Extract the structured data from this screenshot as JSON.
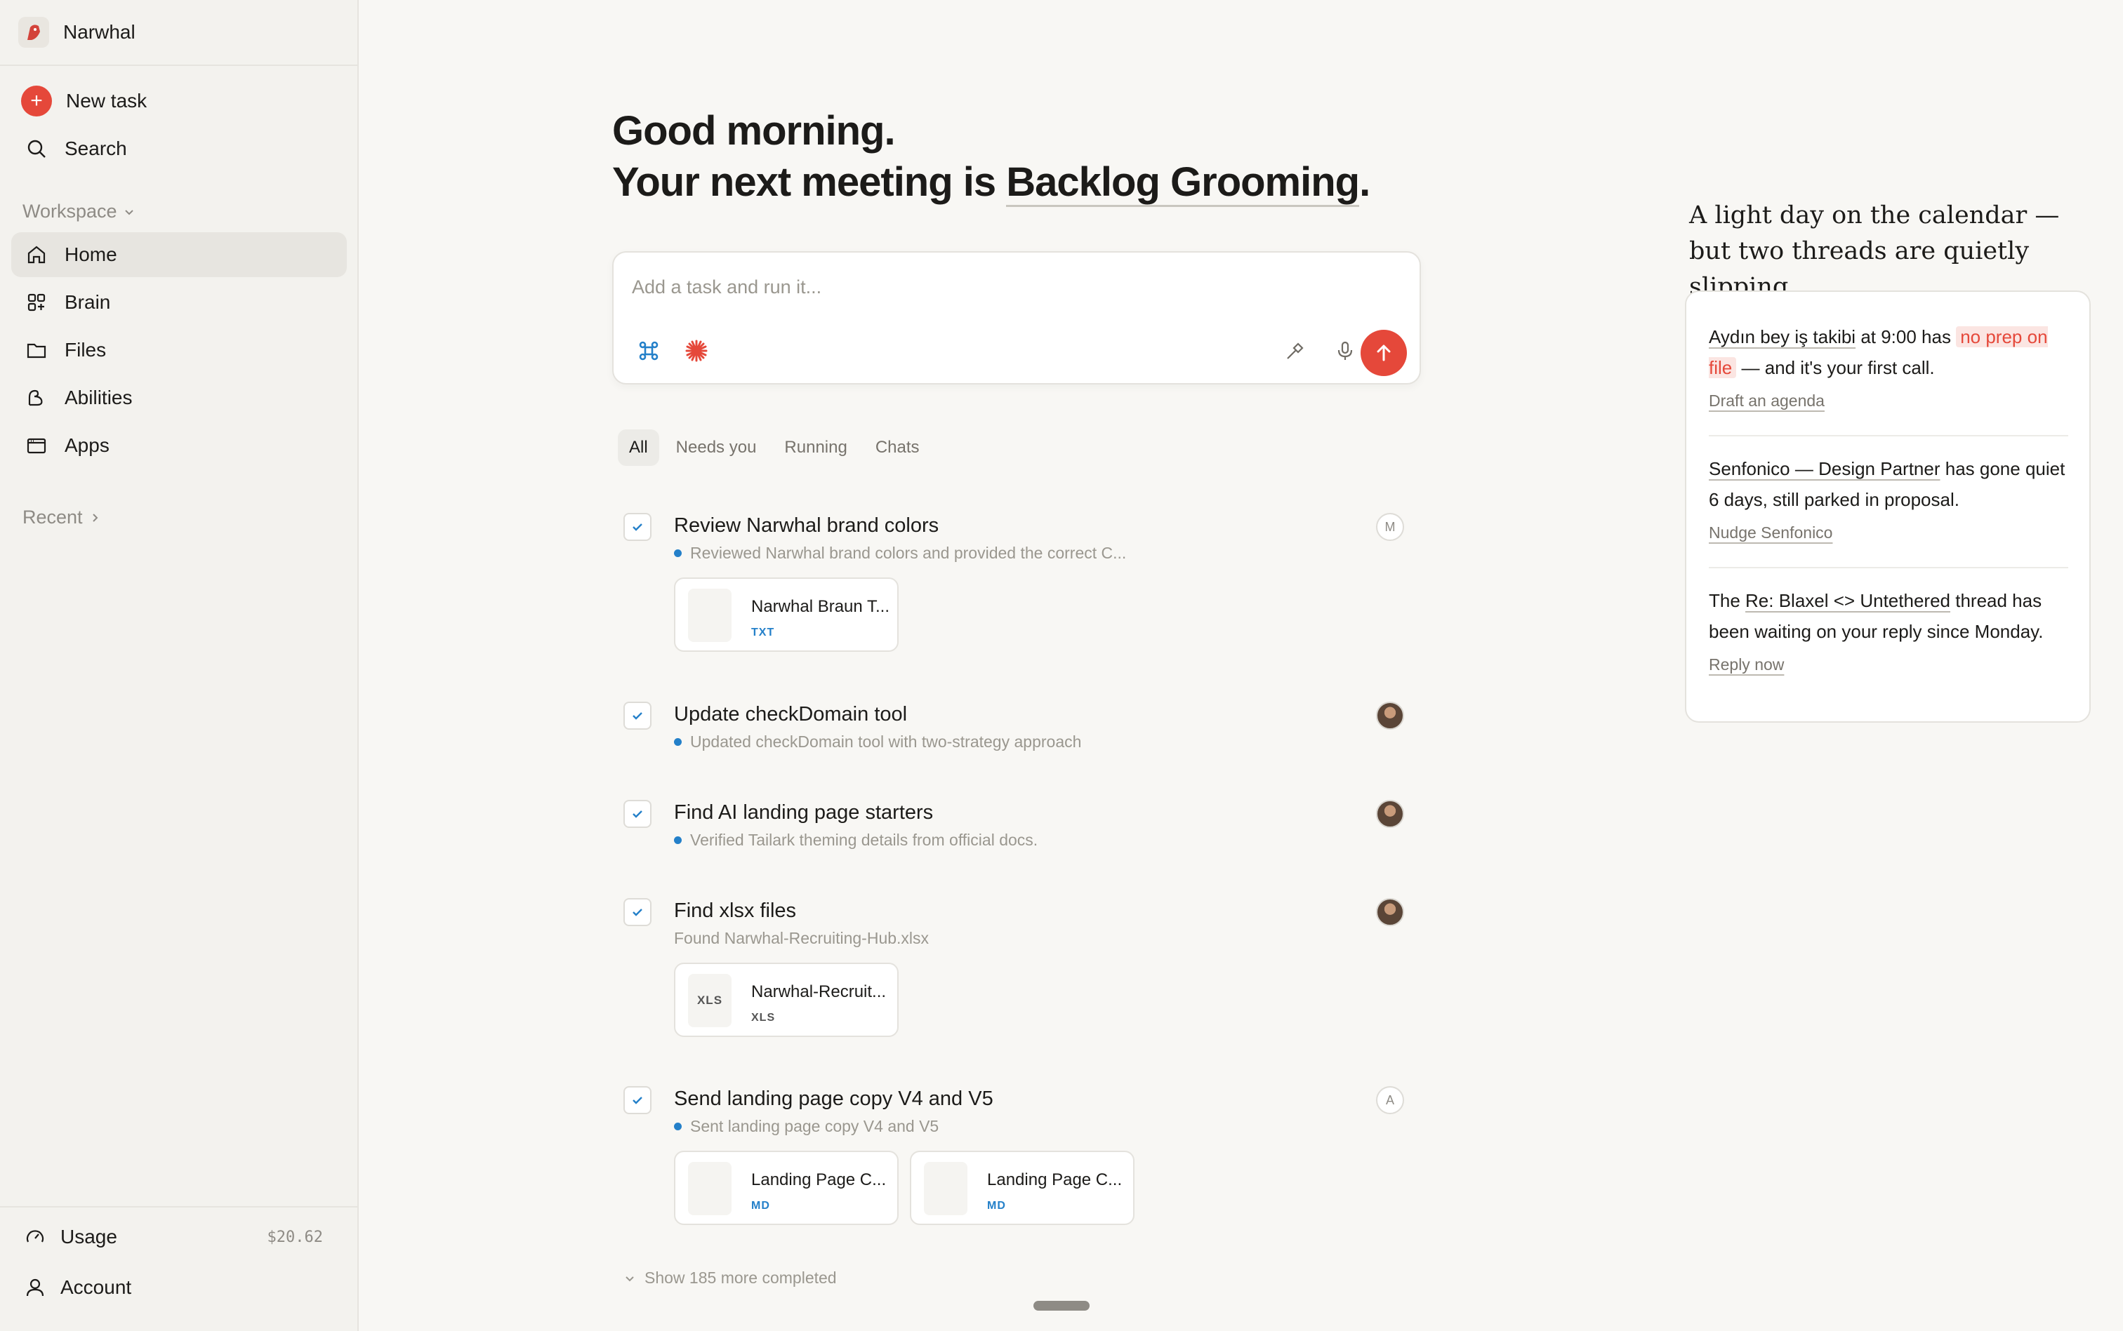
{
  "sidebar": {
    "brand": "Narwhal",
    "new_task": "New task",
    "search": "Search",
    "workspace": "Workspace",
    "nav": [
      {
        "label": "Home",
        "icon": "home-icon"
      },
      {
        "label": "Brain",
        "icon": "brain-icon"
      },
      {
        "label": "Files",
        "icon": "folder-icon"
      },
      {
        "label": "Abilities",
        "icon": "abilities-icon"
      },
      {
        "label": "Apps",
        "icon": "apps-icon"
      }
    ],
    "recent": "Recent",
    "usage": "Usage",
    "usage_amount": "$20.62",
    "account": "Account"
  },
  "main": {
    "greeting_line1": "Good morning.",
    "greeting_line2_prefix": "Your next meeting is ",
    "meeting_name": "Backlog Grooming",
    "greeting_line2_suffix": ".",
    "composer_placeholder": "Add a task and run it...",
    "tabs": [
      "All",
      "Needs you",
      "Running",
      "Chats"
    ],
    "tasks": [
      {
        "title": "Review Narwhal brand colors",
        "subtitle": "Reviewed Narwhal brand colors and provided the correct C...",
        "avatar": "M",
        "files": [
          {
            "name": "Narwhal Braun T...",
            "ext": "TXT"
          }
        ]
      },
      {
        "title": "Update checkDomain tool",
        "subtitle": "Updated checkDomain tool with two-strategy approach"
      },
      {
        "title": "Find AI landing page starters",
        "subtitle": "Verified Tailark theming details from official docs."
      },
      {
        "title": "Find xlsx files",
        "subtitle": "Found Narwhal-Recruiting-Hub.xlsx",
        "files": [
          {
            "name": "Narwhal-Recruit...",
            "ext": "XLS",
            "icon_text": "XLS"
          }
        ]
      },
      {
        "title": "Send landing page copy V4 and V5",
        "subtitle": "Sent landing page copy V4 and V5",
        "avatar": "A",
        "files": [
          {
            "name": "Landing Page C...",
            "ext": "MD"
          },
          {
            "name": "Landing Page C...",
            "ext": "MD"
          }
        ]
      }
    ],
    "show_more": "Show 185 more completed"
  },
  "digest": {
    "heading": "A light day on the calendar — but two threads are quietly slipping.",
    "items": [
      {
        "link": "Aydın bey iş takibi",
        "text1": " at 9:00 has ",
        "highlight": "no prep on file",
        "text2": " — and it's your first call.",
        "action": "Draft an agenda"
      },
      {
        "link": "Senfonico — Design Partner",
        "text1": " has gone quiet 6 days, still parked in proposal.",
        "action": "Nudge Senfonico"
      },
      {
        "prefix": "The ",
        "link": "Re: Blaxel <> Untethered",
        "text1": " thread has been waiting on your reply since Monday.",
        "action": "Reply now"
      }
    ]
  },
  "colors": {
    "accent": "#e5483a",
    "link_blue": "#2480c9",
    "background": "#f8f7f4",
    "sidebar": "#f3f2ee"
  }
}
